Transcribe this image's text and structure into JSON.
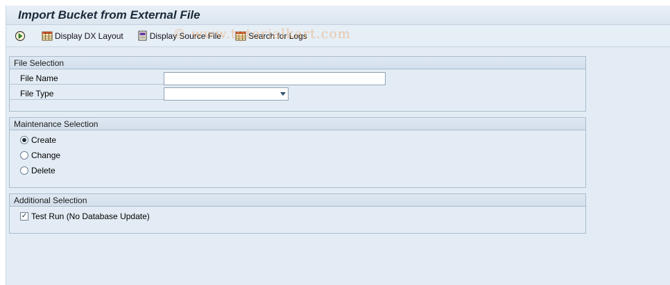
{
  "window": {
    "title": "Import Bucket from External File"
  },
  "toolbar": {
    "execute": {
      "icon": "execute-icon"
    },
    "display_dx_layout": {
      "label": "Display DX Layout",
      "icon": "table-grid-icon"
    },
    "display_source_file": {
      "label": "Display Source File",
      "icon": "pdf-file-icon"
    },
    "search_for_logs": {
      "label": "Search for Logs",
      "icon": "table-grid-icon"
    },
    "watermark": "© www.tutorialkart.com"
  },
  "file_selection": {
    "header": "File Selection",
    "file_name": {
      "label": "File Name",
      "value": ""
    },
    "file_type": {
      "label": "File Type",
      "value": ""
    }
  },
  "maintenance_selection": {
    "header": "Maintenance Selection",
    "options": [
      {
        "label": "Create",
        "checked": true
      },
      {
        "label": "Change",
        "checked": false
      },
      {
        "label": "Delete",
        "checked": false
      }
    ]
  },
  "additional_selection": {
    "header": "Additional Selection",
    "test_run": {
      "label": "Test Run (No Database Update)",
      "checked": true
    }
  },
  "colors": {
    "background": "#e3ecf4",
    "group_border": "#a9bccd",
    "watermark": "#ebaa6e"
  }
}
